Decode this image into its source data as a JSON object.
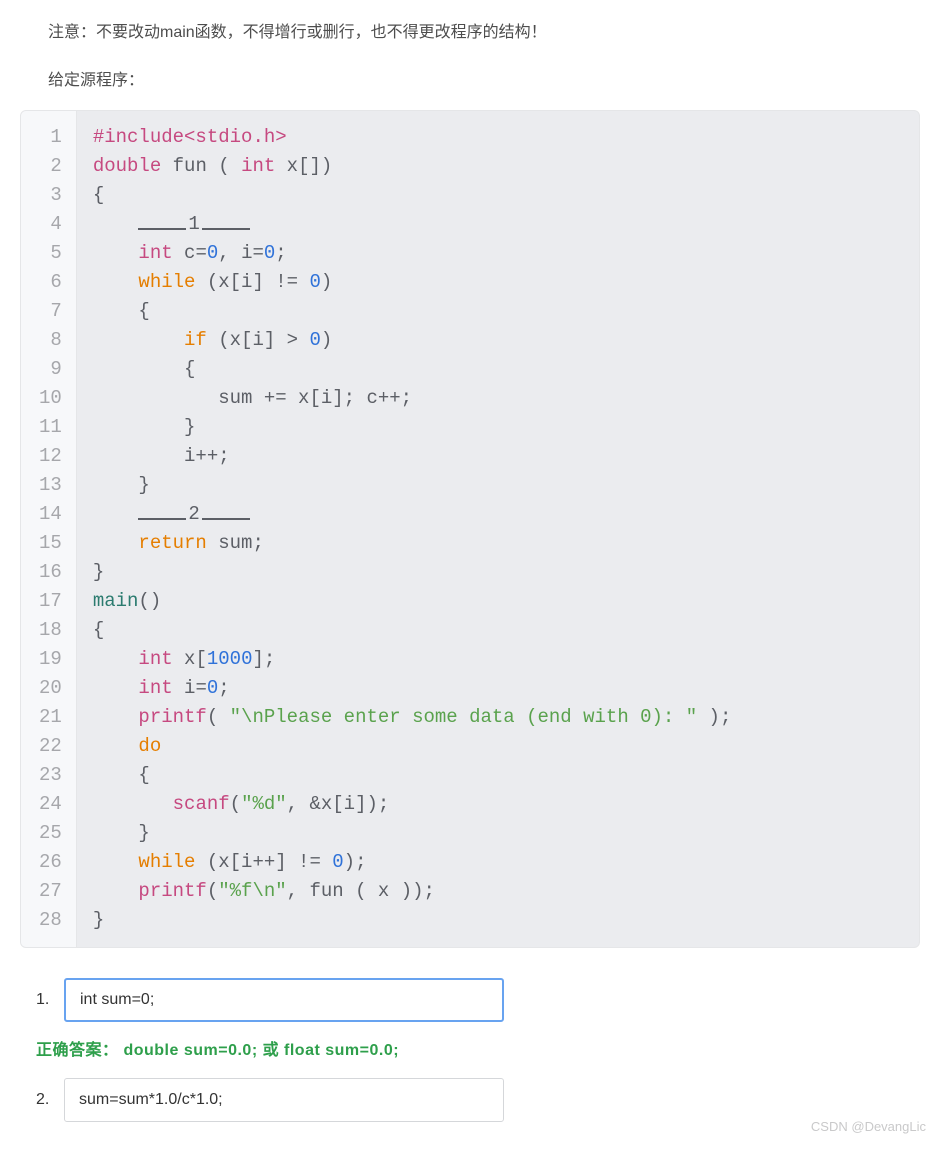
{
  "intro": "注意：不要改动main函数，不得增行或删行，也不得更改程序的结构！",
  "given_label": "给定源程序：",
  "lines": [
    "1",
    "2",
    "3",
    "4",
    "5",
    "6",
    "7",
    "8",
    "9",
    "10",
    "11",
    "12",
    "13",
    "14",
    "15",
    "16",
    "17",
    "18",
    "19",
    "20",
    "21",
    "22",
    "23",
    "24",
    "25",
    "26",
    "27",
    "28"
  ],
  "code": {
    "l1a": "#include<stdio.h>",
    "l2a": "double",
    "l2b": " fun ( ",
    "l2c": "int",
    "l2d": " x[])",
    "l3": "{",
    "l4blank": "1",
    "l5a": "int",
    "l5b": " c=",
    "l5c": "0",
    "l5d": ", i=",
    "l5e": "0",
    "l5f": ";",
    "l6a": "while",
    "l6b": " (x[i] != ",
    "l6c": "0",
    "l6d": ")",
    "l7": "{",
    "l8a": "if",
    "l8b": " (x[i] > ",
    "l8c": "0",
    "l8d": ")",
    "l9": "{",
    "l10": "sum += x[i]; c++;",
    "l11": "}",
    "l12": "i++;",
    "l13": "}",
    "l14blank": "2",
    "l15a": "return",
    "l15b": " sum;",
    "l16": "}",
    "l17a": "main",
    "l17b": "()",
    "l18": "{",
    "l19a": "int",
    "l19b": " x[",
    "l19c": "1000",
    "l19d": "];",
    "l20a": "int",
    "l20b": " i=",
    "l20c": "0",
    "l20d": ";",
    "l21a": "printf",
    "l21b": "( ",
    "l21c": "\"\\nPlease enter some data (end with 0): \"",
    "l21d": " );",
    "l22a": "do",
    "l23": "{",
    "l24a": "scanf",
    "l24b": "(",
    "l24c": "\"%d\"",
    "l24d": ", &x[i]);",
    "l25": "}",
    "l26a": "while",
    "l26b": " (x[i++] != ",
    "l26c": "0",
    "l26d": ");",
    "l27a": "printf",
    "l27b": "(",
    "l27c": "\"%f\\n\"",
    "l27d": ", fun ( x ));",
    "l28": "}"
  },
  "answers": {
    "num1": "1.",
    "val1": "int sum=0;",
    "correct_label": "正确答案：  double sum=0.0;   或   float sum=0.0;",
    "num2": "2.",
    "val2": "sum=sum*1.0/c*1.0;"
  },
  "watermark": "CSDN @DevangLic"
}
